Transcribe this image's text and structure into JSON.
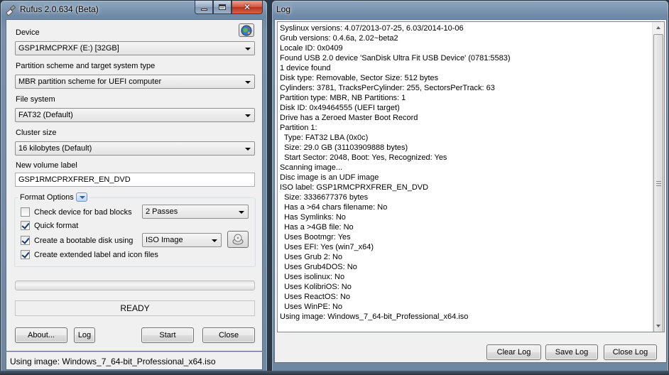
{
  "rufus": {
    "title": "Rufus 2.0.634 (Beta)",
    "device": {
      "label": "Device",
      "value": "GSP1RMCPRXF (E:) [32GB]"
    },
    "partition": {
      "label": "Partition scheme and target system type",
      "value": "MBR partition scheme for UEFI computer"
    },
    "filesystem": {
      "label": "File system",
      "value": "FAT32 (Default)"
    },
    "cluster": {
      "label": "Cluster size",
      "value": "16 kilobytes (Default)"
    },
    "volume": {
      "label": "New volume label",
      "value": "GSP1RMCPRXFRER_EN_DVD"
    },
    "format_options": {
      "title": "Format Options",
      "bad_blocks": {
        "label": "Check device for bad blocks",
        "checked": false,
        "passes": "2 Passes"
      },
      "quick_format": {
        "label": "Quick format",
        "checked": true
      },
      "bootable": {
        "label": "Create a bootable disk using",
        "checked": true,
        "type": "ISO Image"
      },
      "extended_label": {
        "label": "Create extended label and icon files",
        "checked": true
      }
    },
    "progress": 0,
    "status": "READY",
    "buttons": {
      "about": "About...",
      "log": "Log",
      "start": "Start",
      "close": "Close"
    },
    "statusbar": "Using image: Windows_7_64-bit_Professional_x64.iso"
  },
  "log": {
    "title": "Log",
    "lines": [
      "Syslinux versions: 4.07/2013-07-25, 6.03/2014-10-06",
      "Grub versions: 0.4.6a, 2.02~beta2",
      "Locale ID: 0x0409",
      "Found USB 2.0 device 'SanDisk Ultra Fit USB Device' (0781:5583)",
      "1 device found",
      "Disk type: Removable, Sector Size: 512 bytes",
      "Cylinders: 3781, TracksPerCylinder: 255, SectorsPerTrack: 63",
      "Partition type: MBR, NB Partitions: 1",
      "Disk ID: 0x49464555 (UEFI target)",
      "Drive has a Zeroed Master Boot Record",
      "Partition 1:",
      "  Type: FAT32 LBA (0x0c)",
      "  Size: 29.0 GB (31103909888 bytes)",
      "  Start Sector: 2048, Boot: Yes, Recognized: Yes",
      "Scanning image...",
      "Disc image is an UDF image",
      "ISO label: GSP1RMCPRXFRER_EN_DVD",
      "  Size: 3336677376 bytes",
      "  Has a >64 chars filename: No",
      "  Has Symlinks: No",
      "  Has a >4GB file: No",
      "  Uses Bootmgr: Yes",
      "  Uses EFI: Yes (win7_x64)",
      "  Uses Grub 2: No",
      "  Uses Grub4DOS: No",
      "  Uses isolinux: No",
      "  Uses KolibriOS: No",
      "  Uses ReactOS: No",
      "  Uses WinPE: No",
      "Using image: Windows_7_64-bit_Professional_x64.iso"
    ],
    "buttons": {
      "clear": "Clear Log",
      "save": "Save Log",
      "close": "Close Log"
    }
  },
  "icons": {
    "app": "rufus-usb-icon",
    "lang": "globe-icon",
    "iso": "disc-drive-icon",
    "window_min": "minimize-icon",
    "window_max": "maximize-icon",
    "window_close": "close-icon"
  },
  "colors": {
    "titlebar": "#6d88a6",
    "close_button": "#c7432a",
    "window_background": "#f0f0f0"
  }
}
